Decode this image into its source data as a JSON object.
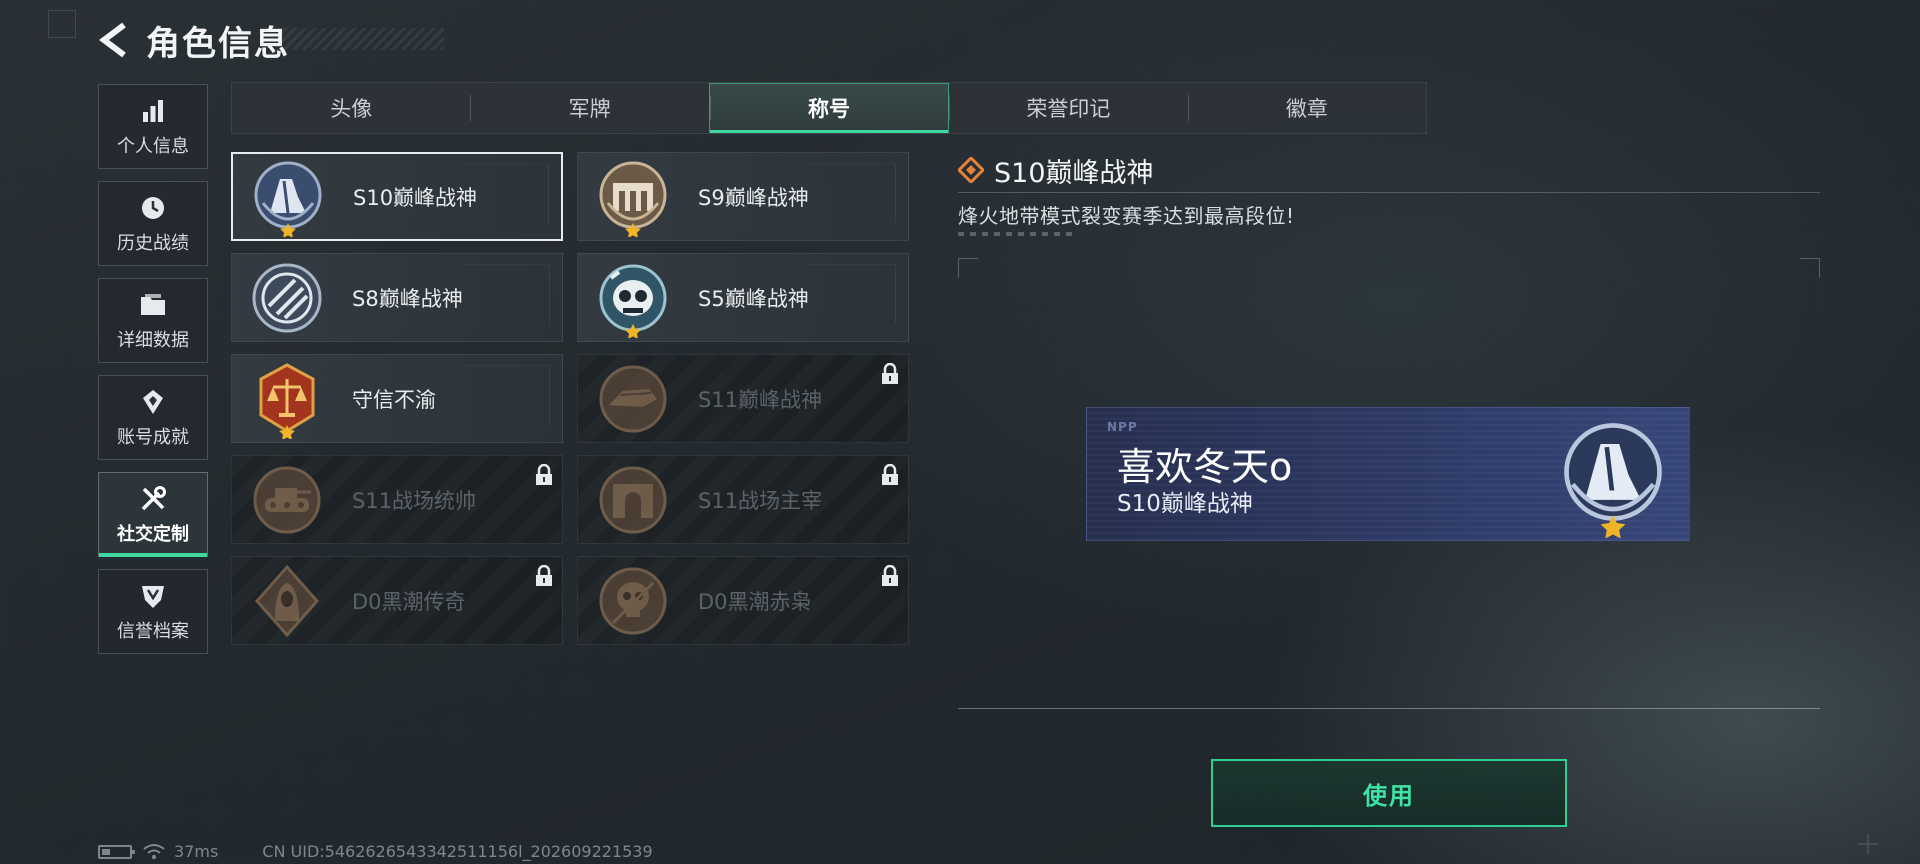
{
  "header": {
    "title": "角色信息"
  },
  "sidebar": {
    "items": [
      {
        "label": "个人信息",
        "icon": "bar-chart-icon"
      },
      {
        "label": "历史战绩",
        "icon": "clock-icon"
      },
      {
        "label": "详细数据",
        "icon": "folder-icon"
      },
      {
        "label": "账号成就",
        "icon": "achievement-icon"
      },
      {
        "label": "社交定制",
        "icon": "tools-icon",
        "active": true
      },
      {
        "label": "信誉档案",
        "icon": "shield-icon"
      }
    ]
  },
  "tabs": [
    {
      "label": "头像"
    },
    {
      "label": "军牌"
    },
    {
      "label": "称号",
      "active": true
    },
    {
      "label": "荣誉印记"
    },
    {
      "label": "徽章"
    }
  ],
  "titles": [
    {
      "name": "S10巅峰战神",
      "selected": true,
      "locked": false,
      "badge": "s10-peak-badge-icon"
    },
    {
      "name": "S9巅峰战神",
      "selected": false,
      "locked": false,
      "badge": "s9-peak-badge-icon"
    },
    {
      "name": "S8巅峰战神",
      "selected": false,
      "locked": false,
      "badge": "s8-peak-badge-icon"
    },
    {
      "name": "S5巅峰战神",
      "selected": false,
      "locked": false,
      "badge": "s5-peak-badge-icon"
    },
    {
      "name": "守信不渝",
      "selected": false,
      "locked": false,
      "badge": "scales-badge-icon"
    },
    {
      "name": "S11巅峰战神",
      "selected": false,
      "locked": true,
      "badge": "s11-peak-badge-icon"
    },
    {
      "name": "S11战场统帅",
      "selected": false,
      "locked": true,
      "badge": "tank-badge-icon"
    },
    {
      "name": "S11战场主宰",
      "selected": false,
      "locked": true,
      "badge": "arch-badge-icon"
    },
    {
      "name": "D0黑潮传奇",
      "selected": false,
      "locked": true,
      "badge": "hooded-figure-badge-icon"
    },
    {
      "name": "D0黑潮赤枭",
      "selected": false,
      "locked": true,
      "badge": "skull-badge-icon"
    }
  ],
  "detail": {
    "title": "S10巅峰战神",
    "description": "烽火地带模式裂变赛季达到最高段位!"
  },
  "preview": {
    "logo_text": "NPP",
    "player_name": "喜欢冬天o",
    "title": "S10巅峰战神"
  },
  "use_button": "使用",
  "footer": {
    "ping": "37ms",
    "uid": "CN UID:5462626543342511156l_202609221539"
  },
  "colors": {
    "accent": "#3fd6a0",
    "nameplate": "#2e3a66",
    "locked_text": "#5b6368"
  }
}
